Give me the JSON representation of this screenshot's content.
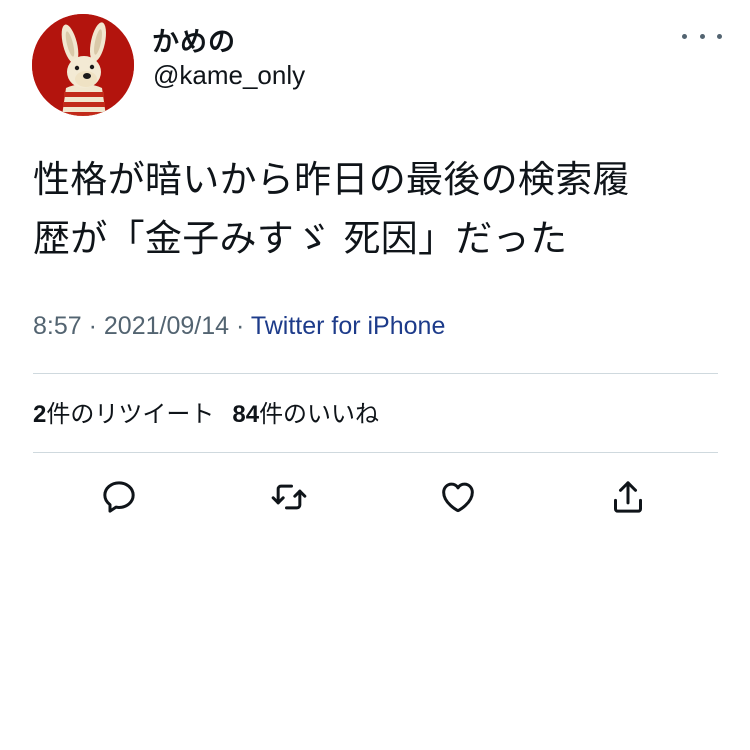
{
  "tweet": {
    "author": {
      "display_name": "かめの",
      "handle": "@kame_only",
      "avatar_icon": "plush-dog-avatar-icon"
    },
    "text_lines": [
      "性格が暗いから昨日の最後の検索履",
      "歴が「金子みすゞ 死因」だった"
    ],
    "time": "8:57",
    "date": "2021/09/14",
    "separator": "·",
    "source": "Twitter for iPhone",
    "stats": {
      "retweets_count": "2",
      "retweets_label": "件のリツイート",
      "likes_count": "84",
      "likes_label": "件のいいね"
    },
    "actions": [
      "reply-icon",
      "retweet-icon",
      "like-icon",
      "share-icon"
    ],
    "more_icon": "more-options-icon"
  },
  "colors": {
    "text_primary": "#0f1419",
    "text_secondary": "#536471",
    "source_link": "#1d3b8a",
    "divider": "#cfd9de",
    "avatar_background": "#b3140d"
  }
}
